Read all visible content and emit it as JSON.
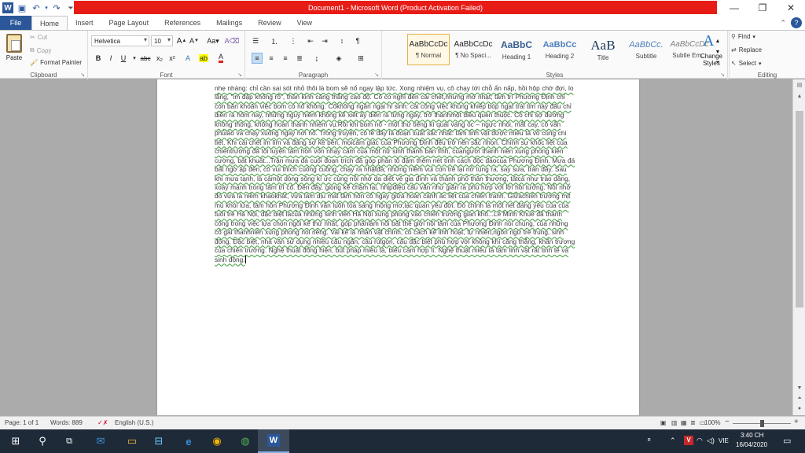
{
  "window": {
    "title": "Document1 - Microsoft Word (Product Activation Failed)",
    "title_bar_color": "#e81c16",
    "accent_color": "#2b579a"
  },
  "tabs": [
    "File",
    "Home",
    "Insert",
    "Page Layout",
    "References",
    "Mailings",
    "Review",
    "View"
  ],
  "clipboard": {
    "paste": "Paste",
    "cut": "Cut",
    "copy": "Copy",
    "format_painter": "Format Painter",
    "label": "Clipboard"
  },
  "font": {
    "name": "Helvetica",
    "size": "10",
    "label": "Font"
  },
  "paragraph": {
    "label": "Paragraph"
  },
  "styles": {
    "label": "Styles",
    "items": [
      {
        "sample": "AaBbCcDc",
        "name": "¶ Normal"
      },
      {
        "sample": "AaBbCcDc",
        "name": "¶ No Spaci..."
      },
      {
        "sample": "AaBbC",
        "name": "Heading 1"
      },
      {
        "sample": "AaBbCc",
        "name": "Heading 2"
      },
      {
        "sample": "AaB",
        "name": "Title"
      },
      {
        "sample": "AaBbCc.",
        "name": "Subtitle"
      },
      {
        "sample": "AaBbCcDc",
        "name": "Subtle Em..."
      }
    ],
    "change": "Change Styles"
  },
  "editing": {
    "find": "Find",
    "replace": "Replace",
    "select": "Select",
    "label": "Editing"
  },
  "document": {
    "text": "nhẹ nhàng: chỉ cần sai sót nhỏ thôi là bom sẽ nổ ngay lập tức. Xong nhiệm vụ, cô chạy tới chỗ ẩn nấp, hồi hộp chờ đợi, lo lắng, \"im đập không rõ\", thần kinh căng thẳng cao độ. Cô có nghĩ đến cái chết,nhưng mờ nhạt; tâm trí Phương Định chỉ còn băn khoăn việc bom có nổ không. Côkhông ngần ngại hi sinh: cái công việc khủng khiếp bóp ngạt trái tim này đâu chỉ diễn ra hôm nay, những nguy hiểm không kể xiết ấy diễn ra từng ngày, trở thànhmột điều quen thuộc. Cô chỉ sợ đường không thông, không hoàn thành nhiệm vụ.Rồi khi bom nổ - một thứ tiếng kì quái váng óc – ngực nhói, mắt cay, cô vẫn phủiáo và chạy xuống ngay nơi nổ. Trong truyện, có lẽ đây là đoạn xuất sắc nhất: tâm linh vật được miêu tả vô cùng chi tiết. Khi cái chết im lìm và đáng sợ kề bên, mọicảm giác của Phương Định đều trở nên sắc nhọn. Chính sự khốc liệt của chiếntrường đã tôi luyện tâm hồn vốn nhạy cảm của một nữ sinh thành bản lĩnh, củangười thanh niên xung phong kiên cường, bất khuất...Trận mưa đá cuối đoạn trích đã góp phần tô đậm thêm nét tính cách độc đáocủa Phương Định. Mưa đá bất ngờ ập đến, cô vui thích cuống cuồng, chạy ra nhặtđá; những niềm vui con trẻ lại nở tung ra, say sưa, tràn đầy. Sau khi mưa tạnh, là cảmột dòng sông kí ức cùng nỗi nhớ da diết về gia đình và thành phố thân thương, tấtcả như trào dâng, xoáy mạnh trong tâm trí cô. Đến đây, giọng kể chậm lại, nhịpđiệu câu văn như giãn ra phù hợp với lời hồi tưởng. Nỗi nhớ đó vừa là niềm khaokhát, vừa làm dịu mát tâm hồn cô ngay giữa hoàn cảnh ác liệt của chiến tranh. Giữachiến trường mịt mù khói lửa, tâm hồn Phương Định vẫn luôn tỏa sáng mộng mơ,lạc quan yêu đời. Đó chính là một nét đáng yêu của của tuổi trẻ Hà Nội, đặc biệt làcủa những sinh viên Hà Nội xung phong vào chiến trường gian khổ...Lê Minh Khuê đã thành công trong việc lựa chọn ngôi kể thứ nhất, góp phầnlàm nổi bật thế giới nội tâm của Phương Định nói chung, của những cô gái thanhniên xung phong nói riêng. Vai kể là nhân vật chính, có cách kể linh hoạt, tự nhiên,ngôn ngữ trẻ trung, sinh động. Đặc biệt, nhà văn sử dụng nhiều câu ngắn, câu rútgọn, câu đặc biệt phù hợp với không khí căng thẳng, khẩn trương của chiến trường. Nghệ thuật đồng hiện, bút pháp miêu tả, biểu cảm hợp lí. Nghệ thuật miêu tả tâm linh vật rất tinh tế và sinh động."
  },
  "status": {
    "page": "Page: 1 of 1",
    "words": "Words: 889",
    "language": "English (U.S.)",
    "zoom": "100%",
    "zoom_fraction": 0.5
  },
  "taskbar": {
    "tray_sup": "ᴿ",
    "lang": "VIE",
    "time": "3:40 CH",
    "date": "16/04/2020"
  }
}
